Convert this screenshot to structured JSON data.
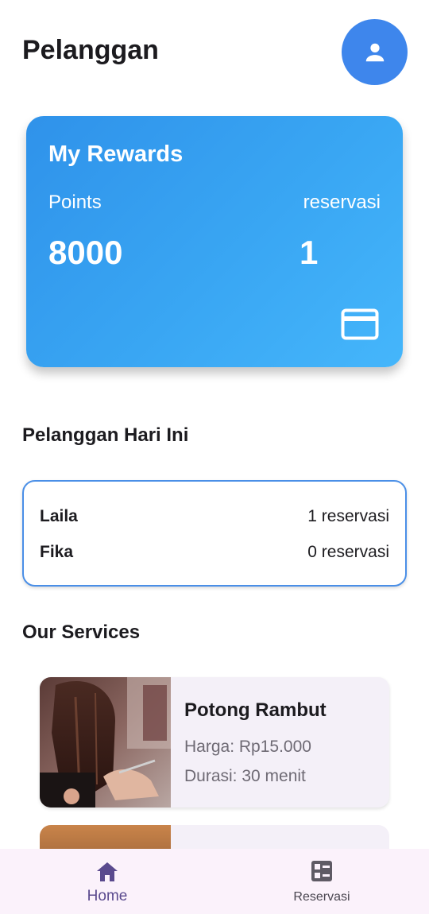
{
  "header": {
    "title": "Pelanggan",
    "profile_icon": "person-icon"
  },
  "rewards": {
    "title": "My Rewards",
    "points_label": "Points",
    "points_value": "8000",
    "reservations_label": "reservasi",
    "reservations_value": "1",
    "card_icon": "credit-card-icon"
  },
  "today": {
    "title": "Pelanggan Hari Ini",
    "customers": [
      {
        "name": "Laila",
        "count": "1 reservasi"
      },
      {
        "name": "Fika",
        "count": "0 reservasi"
      }
    ]
  },
  "services": {
    "title": "Our Services",
    "items": [
      {
        "name": "Potong Rambut",
        "price": "Harga: Rp15.000",
        "duration": "Durasi: 30 menit"
      }
    ]
  },
  "nav": {
    "items": [
      {
        "label": "Home",
        "icon": "home-icon",
        "active": true
      },
      {
        "label": "Reservasi",
        "icon": "list-icon",
        "active": false
      }
    ]
  },
  "colors": {
    "primary": "#3e86ec",
    "card_gradient_start": "#2f92ea",
    "card_gradient_end": "#45b6fb",
    "nav_active": "#5a4a8e"
  }
}
